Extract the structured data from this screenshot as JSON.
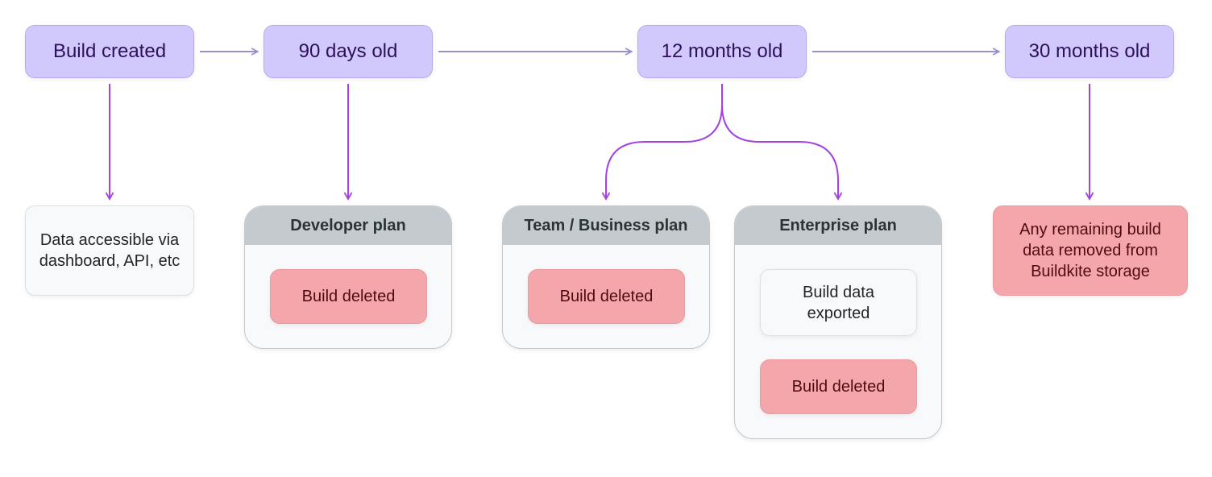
{
  "colors": {
    "stage_fill": "#d1c9fb",
    "stage_text": "#2d0f5e",
    "timeline_arrow": "#9b8fd0",
    "branch_arrow": "#a443e0",
    "deleted_fill": "#f5a6aa",
    "deleted_text": "#4f0b12",
    "plan_header_fill": "#c4cacd",
    "note_fill": "#f8f9fb"
  },
  "stages": [
    {
      "label": "Build created"
    },
    {
      "label": "90 days old"
    },
    {
      "label": "12 months old"
    },
    {
      "label": "30 months old"
    }
  ],
  "outcomes": {
    "build_created": {
      "text": "Data accessible via dashboard, API, etc"
    },
    "thirty_months": {
      "text": "Any remaining build data removed from Buildkite storage"
    }
  },
  "plans": [
    {
      "title": "Developer plan",
      "steps": [
        "Build deleted"
      ]
    },
    {
      "title": "Team / Business plan",
      "steps": [
        "Build deleted"
      ]
    },
    {
      "title": "Enterprise plan",
      "steps": [
        "Build data exported",
        "Build deleted"
      ]
    }
  ]
}
